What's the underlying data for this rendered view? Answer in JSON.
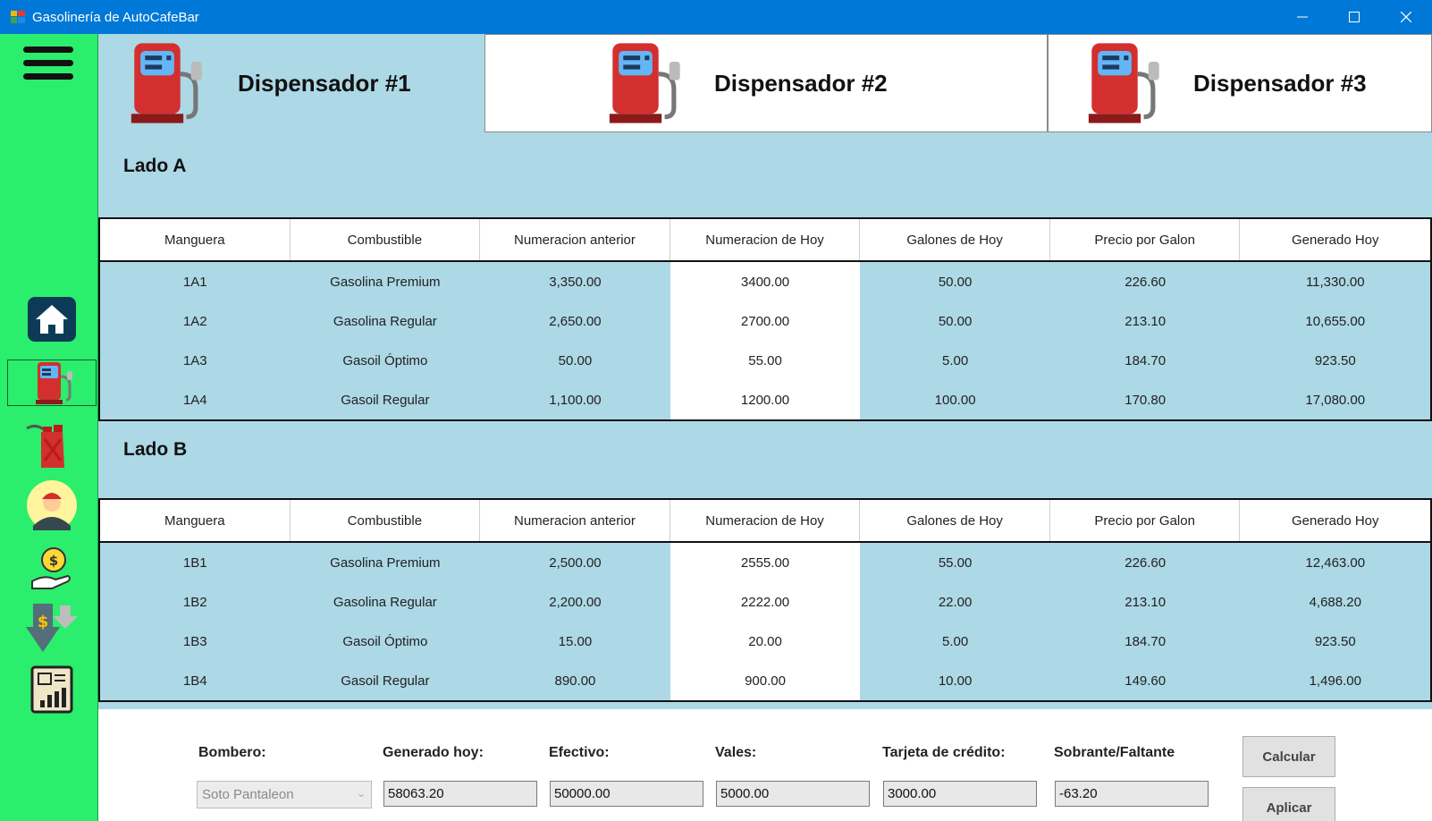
{
  "window": {
    "title": "Gasolinería de AutoCafeBar",
    "minimize": "—",
    "maximize": "☐",
    "close": "✕"
  },
  "tabs": [
    {
      "label": "Dispensador #1",
      "selected": true
    },
    {
      "label": "Dispensador #2",
      "selected": false
    },
    {
      "label": "Dispensador #3",
      "selected": false
    }
  ],
  "sidebar": {
    "items": [
      "home-icon",
      "fuel-pump-icon",
      "fuel-can-icon",
      "attendant-avatar-icon",
      "money-hand-icon",
      "expense-down-icon",
      "report-icon"
    ],
    "active": "fuel-pump-icon"
  },
  "columns": [
    "Manguera",
    "Combustible",
    "Numeracion anterior",
    "Numeracion de Hoy",
    "Galones de Hoy",
    "Precio por Galon",
    "Generado Hoy"
  ],
  "lado_a": {
    "title": "Lado A",
    "rows": [
      [
        "1A1",
        "Gasolina Premium",
        "3,350.00",
        "3400.00",
        "50.00",
        "226.60",
        "11,330.00"
      ],
      [
        "1A2",
        "Gasolina Regular",
        "2,650.00",
        "2700.00",
        "50.00",
        "213.10",
        "10,655.00"
      ],
      [
        "1A3",
        "Gasoil Óptimo",
        "50.00",
        "55.00",
        "5.00",
        "184.70",
        "923.50"
      ],
      [
        "1A4",
        "Gasoil Regular",
        "1,100.00",
        "1200.00",
        "100.00",
        "170.80",
        "17,080.00"
      ]
    ]
  },
  "lado_b": {
    "title": "Lado B",
    "rows": [
      [
        "1B1",
        "Gasolina Premium",
        "2,500.00",
        "2555.00",
        "55.00",
        "226.60",
        "12,463.00"
      ],
      [
        "1B2",
        "Gasolina Regular",
        "2,200.00",
        "2222.00",
        "22.00",
        "213.10",
        "4,688.20"
      ],
      [
        "1B3",
        "Gasoil Óptimo",
        "15.00",
        "20.00",
        "5.00",
        "184.70",
        "923.50"
      ],
      [
        "1B4",
        "Gasoil Regular",
        "890.00",
        "900.00",
        "10.00",
        "149.60",
        "1,496.00"
      ]
    ]
  },
  "summary": {
    "bombero_label": "Bombero:",
    "bombero_value": "Soto Pantaleon",
    "generado_label": "Generado hoy:",
    "generado_value": "58063.20",
    "efectivo_label": "Efectivo:",
    "efectivo_value": "50000.00",
    "vales_label": "Vales:",
    "vales_value": "5000.00",
    "tarjeta_label": "Tarjeta de crédito:",
    "tarjeta_value": "3000.00",
    "sobrante_label": "Sobrante/Faltante",
    "sobrante_value": "-63.20",
    "calcular_label": "Calcular",
    "aplicar_label": "Aplicar"
  },
  "colors": {
    "titlebar": "#0078d7",
    "sidebar": "#2aee6c",
    "panel": "#add8e6",
    "pump_red": "#d32f2f",
    "pump_screen": "#64b5f6"
  }
}
